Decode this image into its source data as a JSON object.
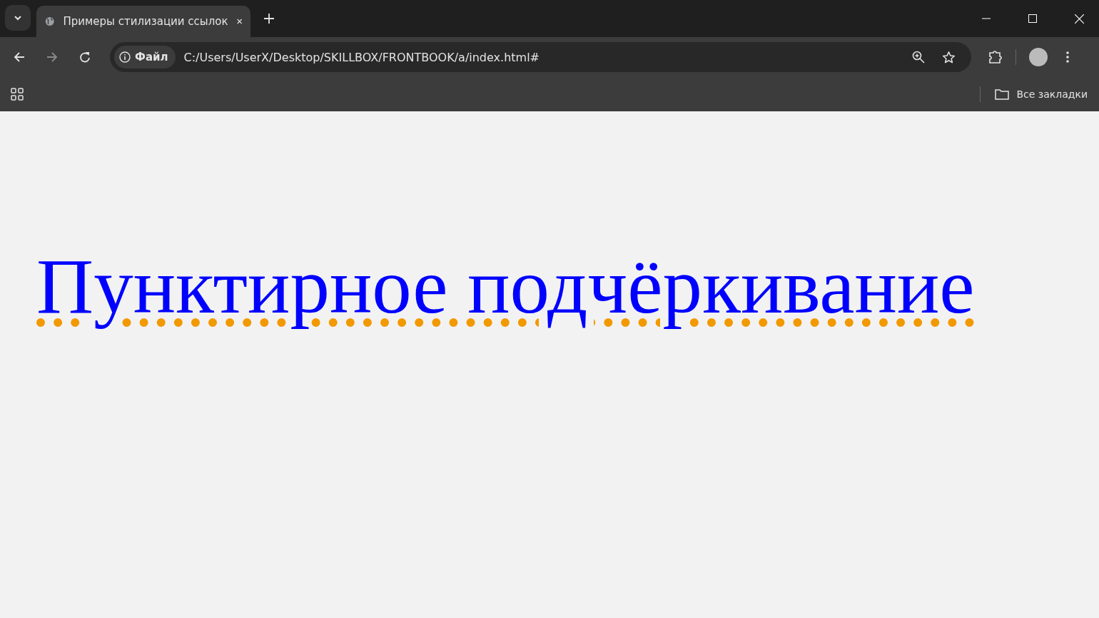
{
  "tabs": [
    {
      "title": "Примеры стилизации ссылок",
      "selected": true
    }
  ],
  "address_bar": {
    "security_chip": "Файл",
    "url": "C:/Users/UserX/Desktop/SKILLBOX/FRONTBOOK/a/index.html#"
  },
  "bookmarks_bar": {
    "all_bookmarks": "Все закладки"
  },
  "page": {
    "link": "Пунктирное подчёркивание"
  }
}
